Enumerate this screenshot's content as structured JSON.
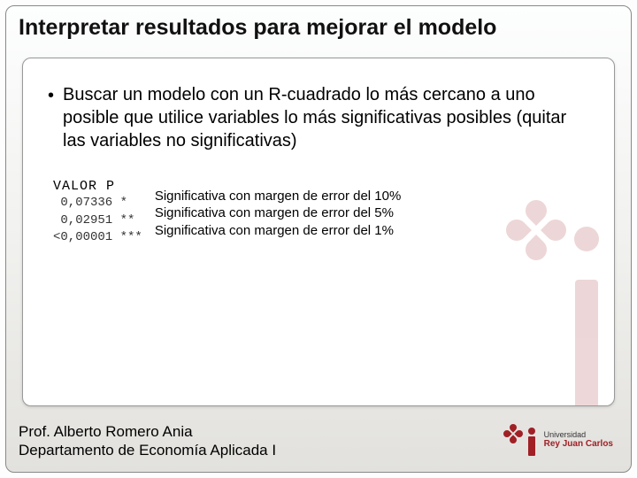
{
  "title": "Interpretar resultados para mejorar el modelo",
  "bullet": "Buscar un modelo con un R-cuadrado lo más cercano a uno posible que utilice variables lo más significativas posibles (quitar las variables no significativas)",
  "pvalue": {
    "header": "VALOR P",
    "rows": [
      {
        "value": " 0,07336 *",
        "label": "Significativa con margen de error del 10%"
      },
      {
        "value": " 0,02951 **",
        "label": "Significativa con margen de error del 5%"
      },
      {
        "value": "<0,00001 ***",
        "label": "Significativa con margen de error del 1%"
      }
    ]
  },
  "footer": {
    "line1": "Prof. Alberto Romero Ania",
    "line2": "Departamento de Economía Aplicada I"
  },
  "logo": {
    "line1": "Universidad",
    "line2": "Rey Juan Carlos"
  }
}
